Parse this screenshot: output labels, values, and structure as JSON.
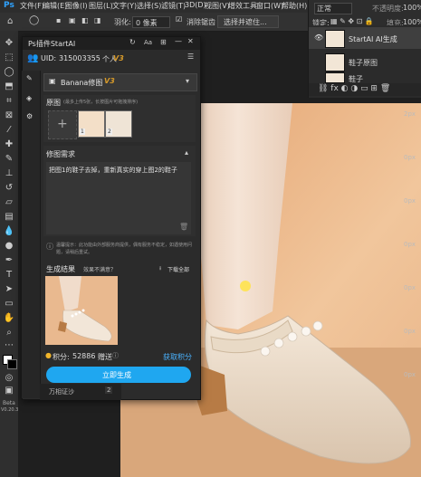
{
  "menubar": {
    "items": [
      "文件(F)",
      "编辑(E)",
      "图像(I)",
      "图层(L)",
      "文字(Y)",
      "选择(S)",
      "滤镜(T)",
      "3D(D)",
      "视图(V)",
      "增效工具",
      "窗口(W)",
      "帮助(H)"
    ]
  },
  "options": {
    "feather_label": "羽化:",
    "feather_value": "0 像素",
    "antialias_label": "消除锯齿",
    "select_subject": "选择并遮住..."
  },
  "right_panel": {
    "blend_mode": "正常",
    "opacity_label": "不透明度:",
    "opacity_value": "100%",
    "lock_label": "锁定:",
    "fill_label": "填充:",
    "fill_value": "100%",
    "layers": [
      {
        "name": "StartAI AI生成"
      },
      {
        "name": "鞋子原图"
      },
      {
        "name": "鞋子"
      }
    ],
    "side_values": [
      "2px",
      "0px",
      "0px",
      "0px",
      "0px",
      "0px",
      "0px"
    ]
  },
  "plugin": {
    "title": "Ps插件StartAI",
    "header_icons": [
      "refresh-icon",
      "text-size-icon",
      "pin-icon",
      "minimize-icon",
      "close-icon"
    ],
    "uid_label": "UID:",
    "uid_value": "315003355",
    "account_type": "个人",
    "account_badge": "V3",
    "model_label": "Banana修图",
    "model_badge": "V3",
    "source_label": "原图",
    "source_hint": "(最多上传5张，长按图片可拖拽排序)",
    "thumb_numbers": [
      "1",
      "2"
    ],
    "prompt_label": "修图需求",
    "prompt_text": "把图1的鞋子去掉，重新真实的穿上图2的鞋子",
    "notice_text": "温馨提示：此功能由外部服务商提供，偶有服务不稳定，如遇使用问题，请稍后重试。",
    "result_label": "生成结果",
    "result_feedback": "效果不满意？",
    "download_all": "下载全部",
    "points_label": "积分:",
    "points_value": "52886",
    "points_extra": "赠送",
    "get_points": "获取积分",
    "generate_button": "立即生成",
    "bottom_tab": "万相证沙",
    "bottom_tab_badge": "2"
  },
  "toolbar": {
    "beta_label": "Beta",
    "version": "V0.20.3"
  },
  "colors": {
    "accent": "#1fa7f0",
    "panel_bg": "#2b2b2b",
    "canvas_bg": "#e9b78a",
    "badge": "#d89b2a"
  }
}
